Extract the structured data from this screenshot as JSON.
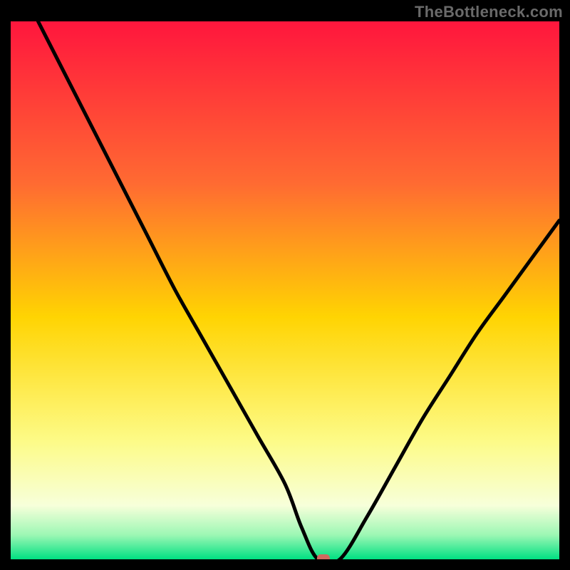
{
  "watermark": "TheBottleneck.com",
  "marker_color": "#d06a5f",
  "curve_color": "#000000",
  "chart_data": {
    "type": "line",
    "title": "",
    "xlabel": "",
    "ylabel": "",
    "xlim": [
      0,
      100
    ],
    "ylim": [
      0,
      100
    ],
    "grid": false,
    "legend": false,
    "gradient_stops": [
      {
        "offset": 0.0,
        "color": "#ff163d"
      },
      {
        "offset": 0.3,
        "color": "#ff6a32"
      },
      {
        "offset": 0.55,
        "color": "#ffd402"
      },
      {
        "offset": 0.78,
        "color": "#fdfb87"
      },
      {
        "offset": 0.9,
        "color": "#f7ffda"
      },
      {
        "offset": 0.955,
        "color": "#9cf7b4"
      },
      {
        "offset": 1.0,
        "color": "#00e082"
      }
    ],
    "series": [
      {
        "name": "bottleneck-curve",
        "x": [
          5,
          10,
          15,
          20,
          25,
          30,
          35,
          40,
          45,
          50,
          53,
          56,
          60,
          65,
          70,
          75,
          80,
          85,
          90,
          95,
          100
        ],
        "y": [
          100,
          90,
          80,
          70,
          60,
          50,
          41,
          32,
          23,
          14,
          6,
          0,
          0,
          8,
          17,
          26,
          34,
          42,
          49,
          56,
          63
        ]
      }
    ],
    "markers": [
      {
        "name": "optimal-point",
        "x": 57,
        "y": 0
      }
    ]
  }
}
